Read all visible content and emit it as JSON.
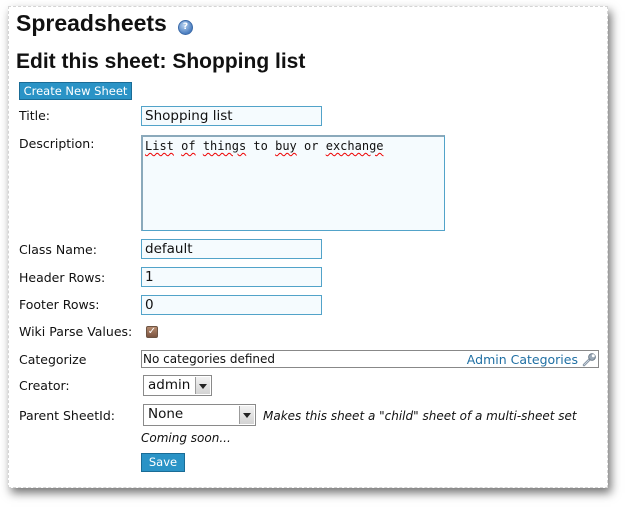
{
  "header": {
    "title": "Spreadsheets",
    "help_icon": "help-question-icon",
    "subtitle": "Edit this sheet: Shopping list"
  },
  "toolbar": {
    "create_label": "Create New Sheet"
  },
  "form": {
    "title_label": "Title:",
    "title_value": "Shopping list",
    "description_label": "Description:",
    "description_words": [
      "List",
      "of",
      "things",
      "to",
      "buy",
      "or",
      "exchange"
    ],
    "classname_label": "Class Name:",
    "classname_value": "default",
    "header_rows_label": "Header Rows:",
    "header_rows_value": "1",
    "footer_rows_label": "Footer Rows:",
    "footer_rows_value": "0",
    "wiki_parse_label": "Wiki Parse Values:",
    "wiki_parse_checked": true,
    "categorize_label": "Categorize",
    "categories_empty": "No categories defined",
    "admin_categories_link": "Admin Categories",
    "admin_icon": "wrench-icon",
    "creator_label": "Creator:",
    "creator_value": "admin",
    "parent_label": "Parent SheetId:",
    "parent_value": "None",
    "parent_hint": "Makes this sheet a \"child\" sheet of a multi-sheet set",
    "coming_soon": "Coming soon...",
    "save_label": "Save"
  },
  "colors": {
    "button_bg": "#2a93c6",
    "input_border": "#52a3c9",
    "link": "#1f6fa3",
    "checkbox": "#8b5e48"
  }
}
